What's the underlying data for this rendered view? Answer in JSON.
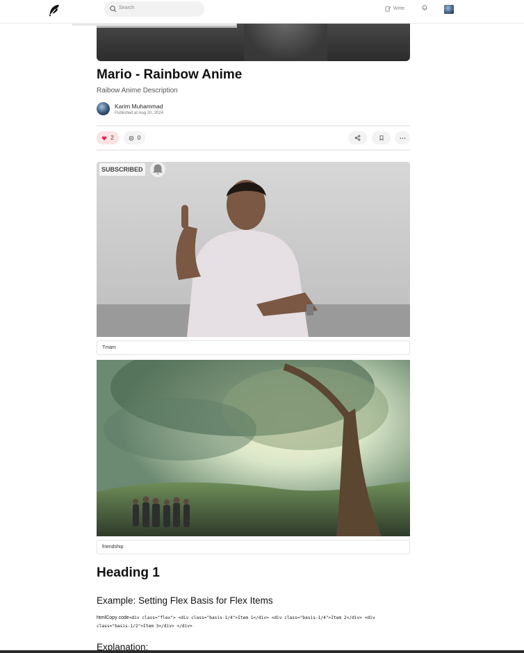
{
  "topbar": {
    "search_placeholder": "Search",
    "write_label": "Write"
  },
  "article": {
    "title": "Mario - Rainbow Anime",
    "description": "Raibow Anime Description",
    "author": {
      "name": "Karim Muhammad",
      "published": "Published at Aug 20, 2024"
    },
    "likes": "2",
    "comments": "0",
    "images": [
      {
        "overlay_text": "SUBSCRIBED",
        "caption": "Tmam"
      },
      {
        "caption": "friendship"
      }
    ],
    "heading1": "Heading 1",
    "heading2": "Example: Setting Flex Basis for Flex Items",
    "code_prefix": "htmlCopy code",
    "code": "<div class=\"flex\"> <div class=\"basis-1/4\">Item 1</div> <div class=\"basis-1/4\">Item 2</div> <div class=\"basis-1/2\">Item 3</div> </div>",
    "heading3": "Explanation:"
  },
  "colors": {
    "like_bg": "#fde3e3",
    "like_heart": "#e0245e",
    "accent": "#111111"
  },
  "icons": [
    "feather-logo-icon",
    "search-icon",
    "edit-icon",
    "bell-icon",
    "heart-icon",
    "comment-icon",
    "share-icon",
    "bookmark-icon",
    "more-icon",
    "bell-subscribe-icon"
  ]
}
